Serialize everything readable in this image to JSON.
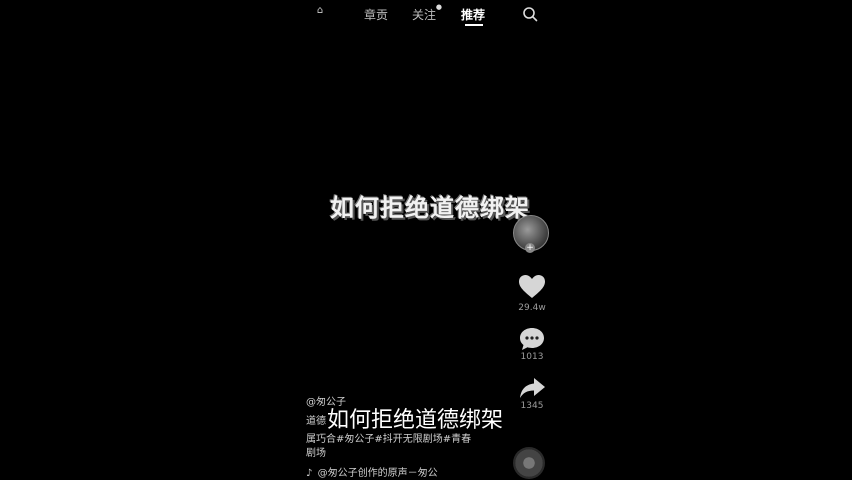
{
  "nav": {
    "home_icon_label": "首页",
    "tabs": [
      {
        "label": "章贡"
      },
      {
        "label": "关注"
      },
      {
        "label": "推荐"
      }
    ],
    "follow_dot": "●",
    "search_icon": "search-icon"
  },
  "video": {
    "center_title": "如何拒绝道德绑架",
    "subtitle": "如何拒绝道德绑架"
  },
  "actions": {
    "like_count": "29.4w",
    "comment_count": "1013",
    "share_count": "1345"
  },
  "caption": {
    "author": "@匆公子",
    "line1": "道德",
    "line2": "属巧合#匆公子#抖开无限剧场#青春",
    "line3": "剧场",
    "music_note": "♪",
    "music": "@匆公子创作的原声－匆公"
  }
}
